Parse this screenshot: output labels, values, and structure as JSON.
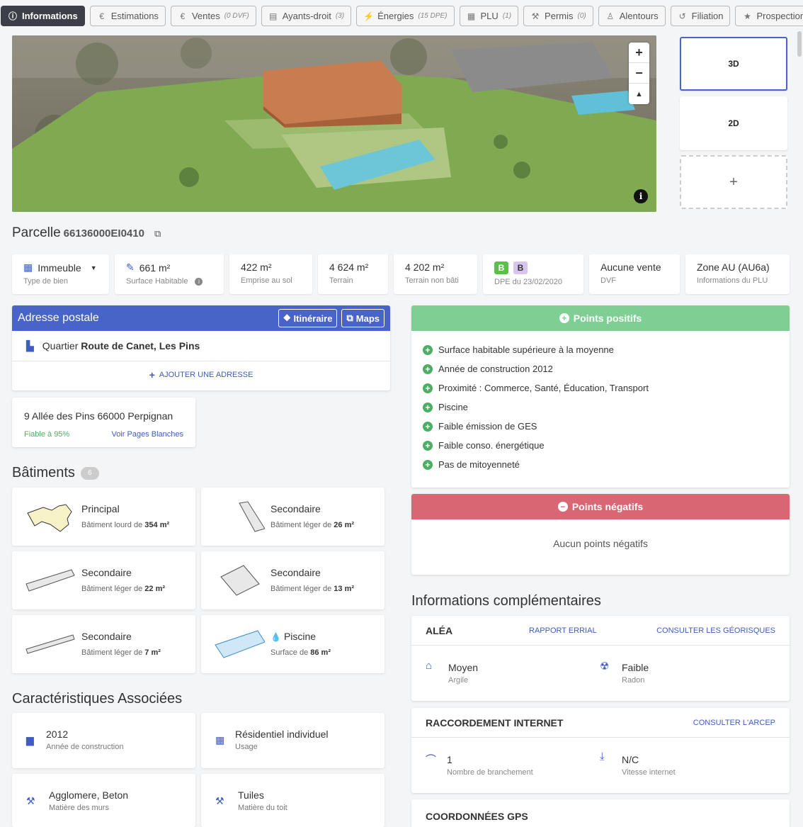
{
  "tabs": [
    {
      "label": "Informations",
      "icon": "info-icon",
      "count": ""
    },
    {
      "label": "Estimations",
      "icon": "euro-icon",
      "count": ""
    },
    {
      "label": "Ventes",
      "icon": "euro-icon",
      "count": "(0 DVF)"
    },
    {
      "label": "Ayants-droit",
      "icon": "id-card-icon",
      "count": "(3)"
    },
    {
      "label": "Énergies",
      "icon": "plug-icon",
      "count": "(15 DPE)"
    },
    {
      "label": "PLU",
      "icon": "document-icon",
      "count": "(1)"
    },
    {
      "label": "Permis",
      "icon": "hammer-icon",
      "count": "(0)"
    },
    {
      "label": "Alentours",
      "icon": "person-pin-icon",
      "count": ""
    },
    {
      "label": "Filiation",
      "icon": "history-icon",
      "count": ""
    },
    {
      "label": "Prospection",
      "icon": "star-icon",
      "count": ""
    }
  ],
  "map": {
    "zoom_in": "+",
    "zoom_out": "−",
    "compass": "▲",
    "info": "i"
  },
  "views": {
    "v3d": "3D",
    "v2d": "2D",
    "add": "+"
  },
  "parcel": {
    "label": "Parcelle",
    "id": "66136000EI0410"
  },
  "stats": [
    {
      "value": "Immeuble",
      "label": "Type de bien"
    },
    {
      "value": "661 m²",
      "label": "Surface Habitable"
    },
    {
      "value": "422 m²",
      "label": "Emprise au sol"
    },
    {
      "value": "4 624 m²",
      "label": "Terrain"
    },
    {
      "value": "4 202 m²",
      "label": "Terrain non bâti"
    },
    {
      "value": "",
      "label": "DPE du 23/02/2020",
      "dpe": [
        "B",
        "B"
      ]
    },
    {
      "value": "Aucune vente",
      "label": "DVF"
    },
    {
      "value": "Zone AU (AU6a)",
      "label": "Informations du PLU"
    }
  ],
  "colors": {
    "accent": "#4864c9",
    "positive": "#7fcf95",
    "negative": "#d96773",
    "dpe_green": "#5cbf4a",
    "dpe_purple": "#d9c4ee"
  },
  "address": {
    "title": "Adresse postale",
    "itineraire": "Itinéraire",
    "maps": "Maps",
    "quartier_prefix": "Quartier",
    "quartier": "Route de Canet, Les Pins",
    "add_label": "AJOUTER UNE ADRESSE",
    "suggestion": "9 Allée des Pins 66000 Perpignan",
    "reliability": "Fiable à 95%",
    "pages_blanches": "Voir Pages Blanches"
  },
  "batiments": {
    "title": "Bâtiments",
    "count": "6",
    "items": [
      {
        "name": "Principal",
        "prefix": "Bâtiment lourd de",
        "area": "354 m²"
      },
      {
        "name": "Secondaire",
        "prefix": "Bâtiment léger de",
        "area": "26 m²"
      },
      {
        "name": "Secondaire",
        "prefix": "Bâtiment léger de",
        "area": "22 m²"
      },
      {
        "name": "Secondaire",
        "prefix": "Bâtiment léger de",
        "area": "13 m²"
      },
      {
        "name": "Secondaire",
        "prefix": "Bâtiment léger de",
        "area": "7 m²"
      },
      {
        "name": "Piscine",
        "prefix": "Surface de",
        "area": "86 m²"
      }
    ]
  },
  "caracteristiques": {
    "title": "Caractéristiques Associées",
    "items": [
      {
        "value": "2012",
        "label": "Année de construction",
        "icon": "calendar-icon"
      },
      {
        "value": "Résidentiel individuel",
        "label": "Usage",
        "icon": "building-icon"
      },
      {
        "value": "Agglomere, Beton",
        "label": "Matière des murs",
        "icon": "hammer-icon"
      },
      {
        "value": "Tuiles",
        "label": "Matière du toit",
        "icon": "hammer-icon"
      }
    ]
  },
  "positifs": {
    "title": "Points positifs",
    "items": [
      "Surface habitable supérieure à la moyenne",
      "Année de construction 2012",
      "Proximité : Commerce, Santé, Éducation, Transport",
      "Piscine",
      "Faible émission de GES",
      "Faible conso. énergétique",
      "Pas de mitoyenneté"
    ]
  },
  "negatifs": {
    "title": "Points négatifs",
    "empty": "Aucun points négatifs"
  },
  "infos": {
    "title": "Informations complémentaires",
    "alea": {
      "title": "ALÉA",
      "link1": "RAPPORT ERRIAL",
      "link2": "CONSULTER LES GÉORISQUES",
      "v1": "Moyen",
      "l1": "Argile",
      "v2": "Faible",
      "l2": "Radon"
    },
    "internet": {
      "title": "RACCORDEMENT INTERNET",
      "link": "CONSULTER L'ARCEP",
      "v1": "1",
      "l1": "Nombre de branchement",
      "v2": "N/C",
      "l2": "Vitesse internet"
    },
    "gps": {
      "title": "COORDONNÉES GPS"
    }
  }
}
